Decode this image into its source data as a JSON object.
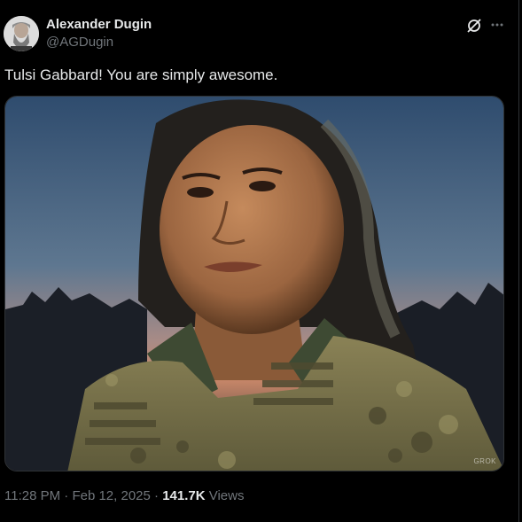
{
  "author": {
    "display_name": "Alexander Dugin",
    "handle": "@AGDugin"
  },
  "icons": {
    "grok": "grok-icon",
    "more": "more-icon"
  },
  "tweet": {
    "text": "Tulsi Gabbard! You are simply awesome.",
    "media_watermark": "GROK"
  },
  "meta": {
    "time": "11:28 PM",
    "separator": "·",
    "date": "Feb 12, 2025",
    "views_count": "141.7K",
    "views_label": "Views"
  },
  "colors": {
    "background": "#000000",
    "text_primary": "#e7e9ea",
    "text_secondary": "#71767b"
  }
}
